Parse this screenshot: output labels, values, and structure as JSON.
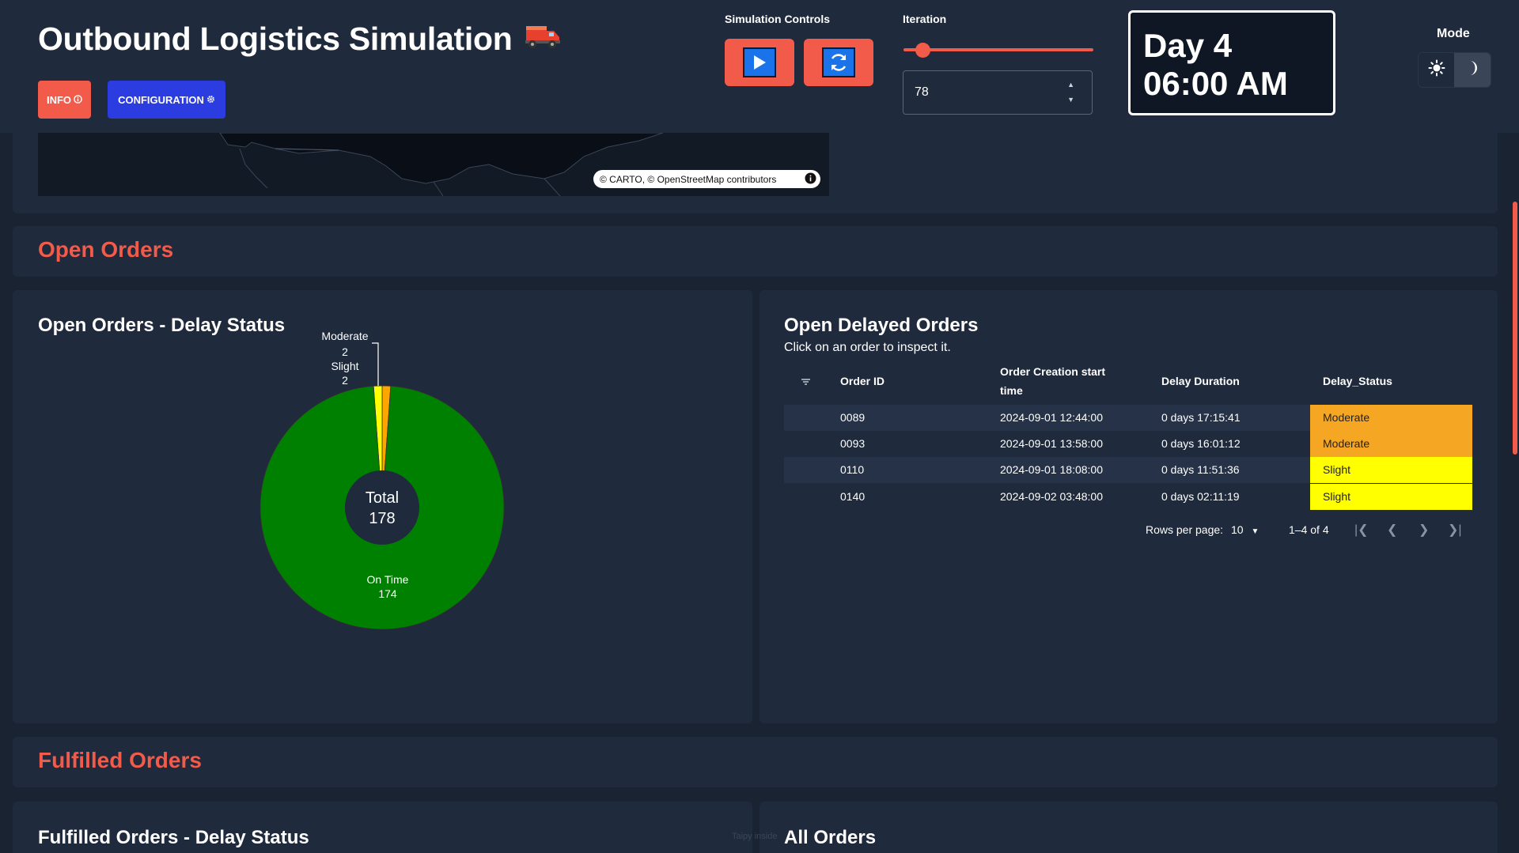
{
  "header": {
    "title": "Outbound Logistics Simulation",
    "title_emoji": "🚚",
    "info_button": "INFO",
    "config_button": "CONFIGURATION",
    "sim_controls_label": "Simulation Controls",
    "iteration_label": "Iteration",
    "iteration_value": "78",
    "iteration_slider_fraction": 0.1,
    "day_line": "Day 4",
    "time_line": "06:00 AM",
    "mode_label": "Mode"
  },
  "map": {
    "attribution": "© CARTO, © OpenStreetMap contributors"
  },
  "open_orders": {
    "section_title": "Open Orders",
    "chart_card_title": "Open Orders - Delay Status",
    "table_card_title": "Open Delayed Orders",
    "table_subtitle": "Click on an order to inspect it.",
    "columns": [
      "Order ID",
      "Order Creation start time",
      "Delay Duration",
      "Delay_Status"
    ],
    "rows": [
      {
        "id": "0089",
        "created": "2024-09-01 12:44:00",
        "delay": "0 days 17:15:41",
        "status": "Moderate"
      },
      {
        "id": "0093",
        "created": "2024-09-01 13:58:00",
        "delay": "0 days 16:01:12",
        "status": "Moderate"
      },
      {
        "id": "0110",
        "created": "2024-09-01 18:08:00",
        "delay": "0 days 11:51:36",
        "status": "Slight"
      },
      {
        "id": "0140",
        "created": "2024-09-02 03:48:00",
        "delay": "0 days 02:11:19",
        "status": "Slight"
      }
    ],
    "rows_per_page_label": "Rows per page:",
    "rows_per_page": "10",
    "range_label": "1–4 of 4"
  },
  "chart_data": {
    "type": "pie",
    "title": "Open Orders - Delay Status",
    "categories": [
      "On Time",
      "Slight",
      "Moderate"
    ],
    "values": [
      174,
      2,
      2
    ],
    "colors": [
      "#008000",
      "#ffff00",
      "#ffa500"
    ],
    "center_label": "Total",
    "center_value": "178",
    "hole": true
  },
  "status_colors": {
    "Moderate": "#f5a623",
    "Slight": "#ffff00"
  },
  "fulfilled_orders": {
    "section_title": "Fulfilled Orders",
    "chart_card_title": "Fulfilled Orders - Delay Status",
    "table_card_title": "All Orders"
  },
  "footer": {
    "watermark": "Taipy inside"
  }
}
